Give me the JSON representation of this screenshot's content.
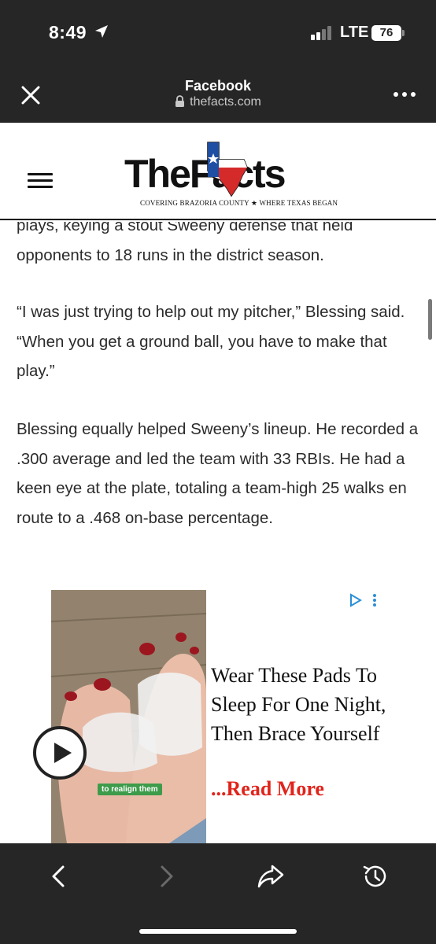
{
  "status_bar": {
    "time": "8:49",
    "network": "LTE",
    "battery": "76"
  },
  "browser": {
    "title": "Facebook",
    "url": "thefacts.com"
  },
  "site": {
    "logo_text": "TheFacts",
    "tagline": "COVERING BRAZORIA COUNTY ★ WHERE TEXAS BEGAN"
  },
  "article": {
    "paragraphs": [
      "plays, keying a stout Sweeny defense that held opponents to 18 runs in the district season.",
      "“I was just trying to help out my pitcher,” Blessing said. “When you get a ground ball, you have to make that play.”",
      "Blessing equally helped Sweeny’s lineup. He recorded a .300 average and led the team with 33 RBIs. He had a keen eye at the plate, totaling a team-high 25 walks en route to a .468 on-base percentage."
    ]
  },
  "ad": {
    "caption": "to realign them",
    "headline": "Wear These Pads To Sleep For One Night, Then Brace Yourself",
    "read_more": "...Read More"
  },
  "colors": {
    "chrome": "#262626",
    "ad_red": "#e0241b",
    "caption_green": "#3d9b4a"
  },
  "icons": [
    "location-arrow-icon",
    "signal-icon",
    "close-icon",
    "lock-icon",
    "more-dots-icon",
    "hamburger-icon",
    "play-icon",
    "adchoices-icon",
    "back-icon",
    "forward-icon",
    "share-icon",
    "history-icon"
  ]
}
